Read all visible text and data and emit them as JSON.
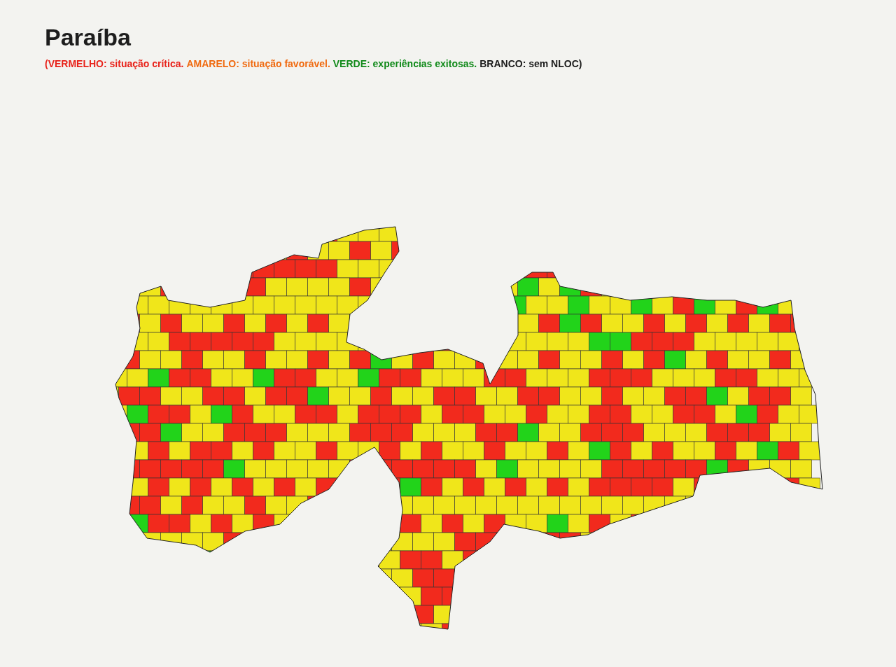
{
  "title": "Paraíba",
  "legend": [
    {
      "text": "(VERMELHO: situação crítica.",
      "color": "#e8221a"
    },
    {
      "text": "AMARELO: situação favorável.",
      "color": "#f06a10"
    },
    {
      "text": "VERDE: experiências exitosas.",
      "color": "#118a1a"
    },
    {
      "text": "BRANCO: sem NLOC)",
      "color": "#1a1a1a"
    }
  ]
}
